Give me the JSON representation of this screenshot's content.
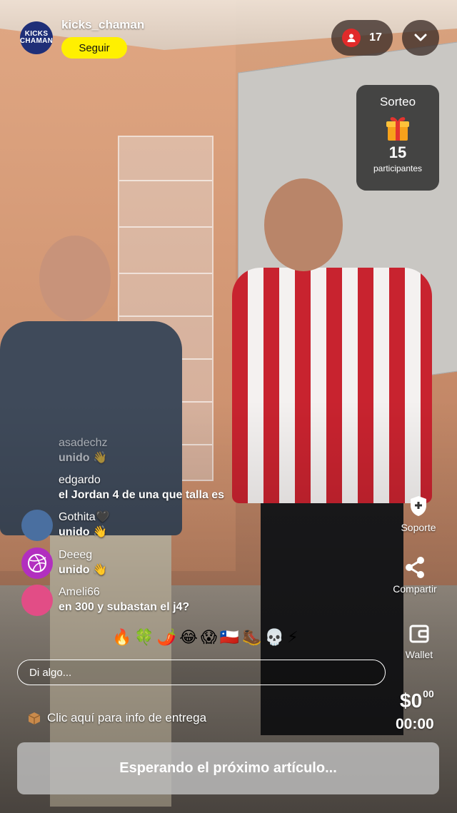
{
  "header": {
    "avatar_text": "KICKS CHAMAN",
    "username": "kicks_chaman",
    "follow_label": "Seguir",
    "viewer_count": "17"
  },
  "giveaway": {
    "title": "Sorteo",
    "count": "15",
    "label": "participantes"
  },
  "side_actions": {
    "support": "Soporte",
    "share": "Compartir",
    "wallet": "Wallet"
  },
  "chat": {
    "messages": [
      {
        "user": "asadechz",
        "text": "unido 👋",
        "avatar_color": "#2a3a2a"
      },
      {
        "user": "edgardo",
        "text": "el Jordan 4 de una que talla es",
        "avatar_color": ""
      },
      {
        "user": "Gothita🖤",
        "text": "unido 👋",
        "avatar_color": "#4a6fa0"
      },
      {
        "user": "Deeeg",
        "text": "unido 👋",
        "avatar_color": "#b22fbf"
      },
      {
        "user": "Ameli66",
        "text": "en 300 y subastan el j4?",
        "avatar_color": "#e24d86"
      }
    ],
    "emoji_reactions": [
      "🔥",
      "🍀",
      "🌶️",
      "😂",
      "😱",
      "🇨🇱",
      "🥾",
      "💀",
      "⚡"
    ]
  },
  "input": {
    "placeholder": "Di algo..."
  },
  "delivery": {
    "text": "Clic aquí para info de entrega"
  },
  "price": {
    "main": "$0",
    "cents": "00"
  },
  "timer": "00:00",
  "status_banner": "Esperando el próximo artículo...",
  "colors": {
    "follow_bg": "#fff000",
    "viewer_dot": "#e12a2a"
  }
}
